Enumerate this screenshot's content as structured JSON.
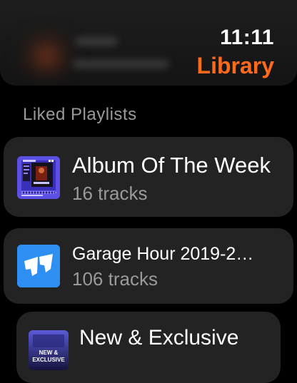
{
  "header": {
    "time": "11:11",
    "title": "Library"
  },
  "section_title": "Liked Playlists",
  "accent_color": "#ff6a1a",
  "playlists": [
    {
      "name": "Album Of The Week",
      "tracks": "16 tracks",
      "icon": "album-of-the-week-artwork"
    },
    {
      "name": "Garage Hour 2019-2…",
      "tracks": "106 tracks",
      "icon": "rinse-logo-artwork"
    },
    {
      "name": "New & Exclusive",
      "tracks": "",
      "icon": "new-and-exclusive-artwork",
      "art_text": "NEW & EXCLUSIVE"
    }
  ]
}
